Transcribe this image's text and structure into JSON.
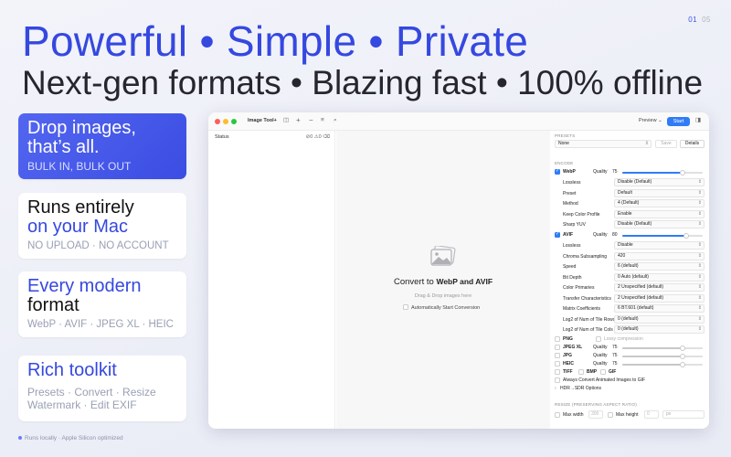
{
  "pager": {
    "current": "01",
    "total": "05"
  },
  "headline": "Powerful • Simple • Private",
  "subline": "Next-gen formats • Blazing fast • 100% offline",
  "cards": [
    {
      "title": "Drop images,\nthat’s all.",
      "subtitle": "BULK IN, BULK OUT"
    },
    {
      "title_line1": "Runs entirely",
      "title_line2": "on your Mac",
      "subtitle": "NO UPLOAD · NO ACCOUNT"
    },
    {
      "title_line1": "Every modern",
      "title_line2": "format",
      "subtitle": "WebP · AVIF · JPEG XL · HEIC"
    },
    {
      "title": "Rich toolkit",
      "subtitle_line1": "Presets · Convert · Resize",
      "subtitle_line2": "Watermark · Edit EXIF"
    }
  ],
  "footnote": "Runs locally · Apple Silicon optimized",
  "app": {
    "title": "Image Tool+",
    "preview_label": "Preview ⌄",
    "start_label": "Start",
    "status_label": "Status",
    "status_counts": "⊘0 ⚠0 ⌫",
    "convert_prefix": "Convert to",
    "convert_formats": "WebP and AVIF",
    "drop_hint": "Drag & Drop images here",
    "auto_start": "Automatically Start Conversion",
    "presets_section": "PRESETS",
    "preset_value": "None",
    "save_label": "Save",
    "details_label": "Details",
    "encode_section": "ENCODE",
    "webp": {
      "label": "WebP",
      "quality_label": "Quality",
      "quality": 75
    },
    "webp_rows": [
      {
        "label": "Lossless",
        "value": "Disable (Default)"
      },
      {
        "label": "Preset",
        "value": "Default"
      },
      {
        "label": "Method",
        "value": "4 (Default)"
      },
      {
        "label": "Keep Color Profile",
        "value": "Enable"
      },
      {
        "label": "Sharp YUV",
        "value": "Disable (Default)"
      }
    ],
    "avif": {
      "label": "AVIF",
      "quality_label": "Quality",
      "quality": 80
    },
    "avif_rows": [
      {
        "label": "Lossless",
        "value": "Disable"
      },
      {
        "label": "Chroma Subsampling",
        "value": "420"
      },
      {
        "label": "Speed",
        "value": "6 (default)"
      },
      {
        "label": "Bit Depth",
        "value": "0  Auto (default)"
      },
      {
        "label": "Color Primaries",
        "value": "2  Unspecified (default)"
      },
      {
        "label": "Transfer Characteristics",
        "value": "2  Unspecified (default)"
      },
      {
        "label": "Matrix Coefficients",
        "value": "6  BT.601 (default)"
      },
      {
        "label": "Log2 of Num of Tile Rows",
        "value": "0 (default)"
      },
      {
        "label": "Log2 of Num of Tile Cols",
        "value": "0 (default)"
      }
    ],
    "png": {
      "label": "PNG",
      "lossy_label": "Lossy compression"
    },
    "jpegxl": {
      "label": "JPEG XL",
      "quality_label": "Quality",
      "quality": 75
    },
    "jpg": {
      "label": "JPG",
      "quality_label": "Quality",
      "quality": 75
    },
    "heic": {
      "label": "HEIC",
      "quality_label": "Quality",
      "quality": 75
    },
    "tiff": "TIFF",
    "bmp": "BMP",
    "gif": "GIF",
    "always_gif": "Always Convert Animated Images to GIF",
    "hdr_sdr": "HDR→SDR Options",
    "resize_section": "RESIZE (PRESERVING ASPECT RATIO)",
    "max_width_label": "Max width",
    "max_width_placeholder": "300",
    "max_height_label": "Max height",
    "max_height_placeholder": "0",
    "unit": "px"
  },
  "colors": {
    "accent": "#3548e0",
    "blue_button": "#2f7cf6"
  }
}
